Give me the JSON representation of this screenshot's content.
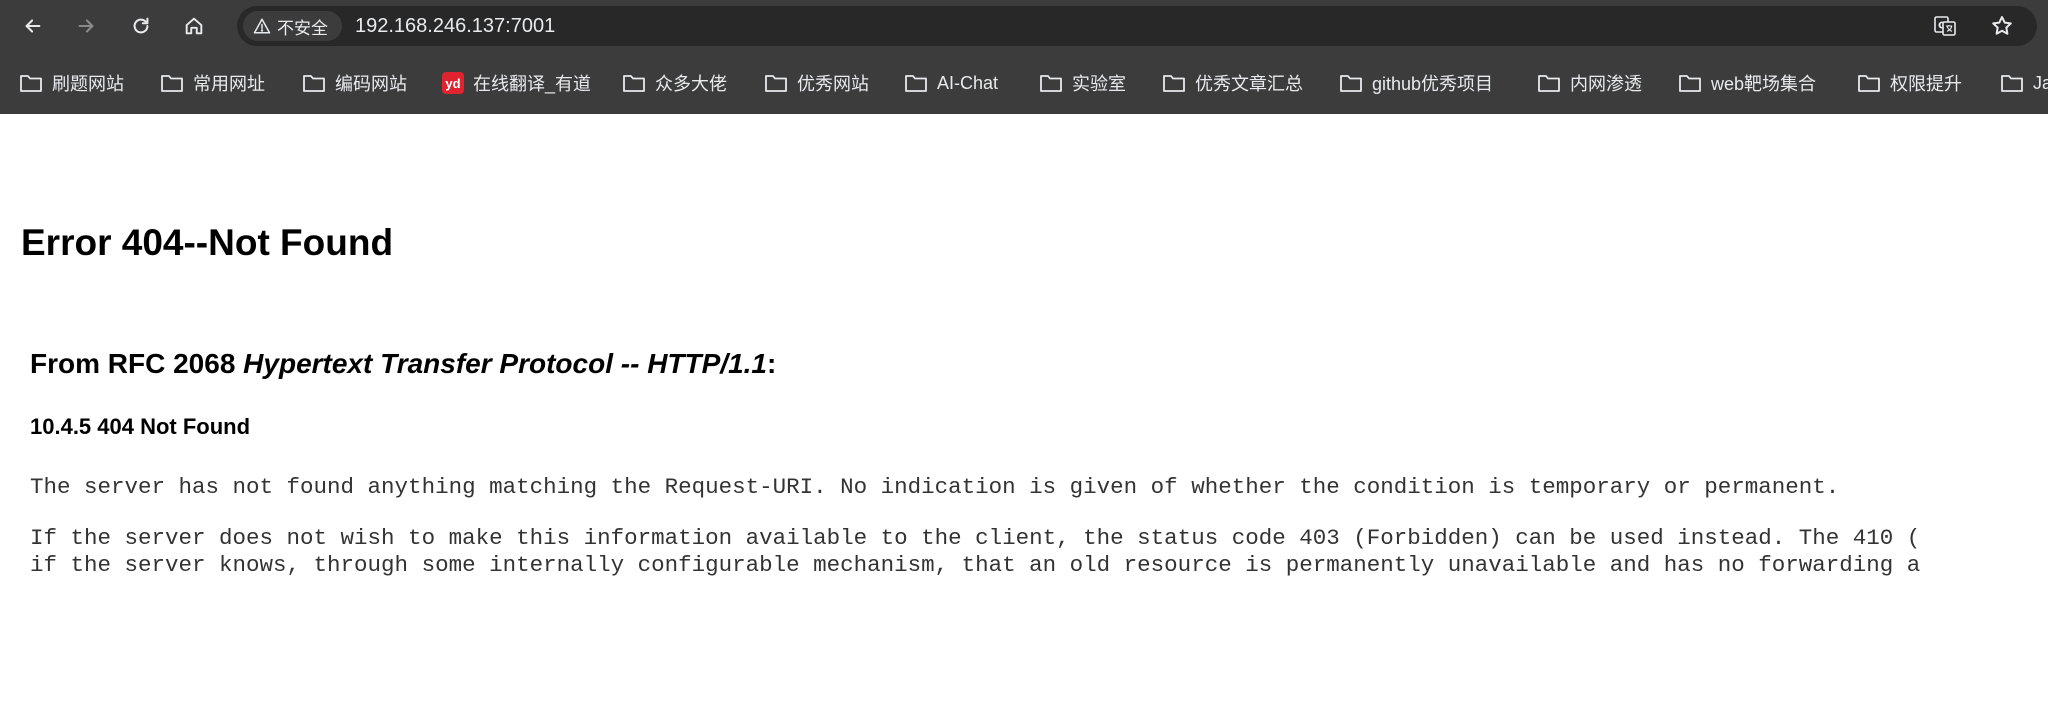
{
  "browser": {
    "security_label": "不安全",
    "url": "192.168.246.137:7001",
    "icons": {
      "back": "arrow-left-icon",
      "forward": "arrow-right-icon",
      "reload": "reload-icon",
      "home": "home-icon",
      "warning": "warning-triangle-icon",
      "translate": "translate-icon",
      "bookmark": "star-icon"
    }
  },
  "bookmarks": [
    {
      "label": "刷题网站",
      "icon": "folder-icon"
    },
    {
      "label": "常用网址",
      "icon": "folder-icon"
    },
    {
      "label": "编码网站",
      "icon": "folder-icon"
    },
    {
      "label": "在线翻译_有道",
      "icon": "youdao-logo",
      "logo_text": "yd"
    },
    {
      "label": "众多大佬",
      "icon": "folder-icon"
    },
    {
      "label": "优秀网站",
      "icon": "folder-icon"
    },
    {
      "label": "AI-Chat",
      "icon": "folder-icon"
    },
    {
      "label": "实验室",
      "icon": "folder-icon"
    },
    {
      "label": "优秀文章汇总",
      "icon": "folder-icon"
    },
    {
      "label": "github优秀项目",
      "icon": "folder-icon"
    },
    {
      "label": "内网渗透",
      "icon": "folder-icon"
    },
    {
      "label": "web靶场集合",
      "icon": "folder-icon"
    },
    {
      "label": "权限提升",
      "icon": "folder-icon"
    },
    {
      "label": "Ja",
      "icon": "folder-icon"
    }
  ],
  "page": {
    "title": "Error 404--Not Found",
    "rfc_prefix": "From RFC 2068 ",
    "rfc_italic": "Hypertext Transfer Protocol -- HTTP/1.1",
    "rfc_suffix": ":",
    "section_heading": "10.4.5 404 Not Found",
    "paragraph1": "The server has not found anything matching the Request-URI. No indication is given of whether the condition is temporary or permanent.",
    "paragraph2_line1": "If the server does not wish to make this information available to the client, the status code 403 (Forbidden) can be used instead. The 410 (",
    "paragraph2_line2": "if the server knows, through some internally configurable mechanism, that an old resource is permanently unavailable and has no forwarding a"
  },
  "colors": {
    "chrome_bar": "#3c3c3c",
    "omnibox": "#282828",
    "chrome_text": "#e8eaed",
    "page_bg": "#ffffff",
    "youdao_red": "#e0242f"
  }
}
